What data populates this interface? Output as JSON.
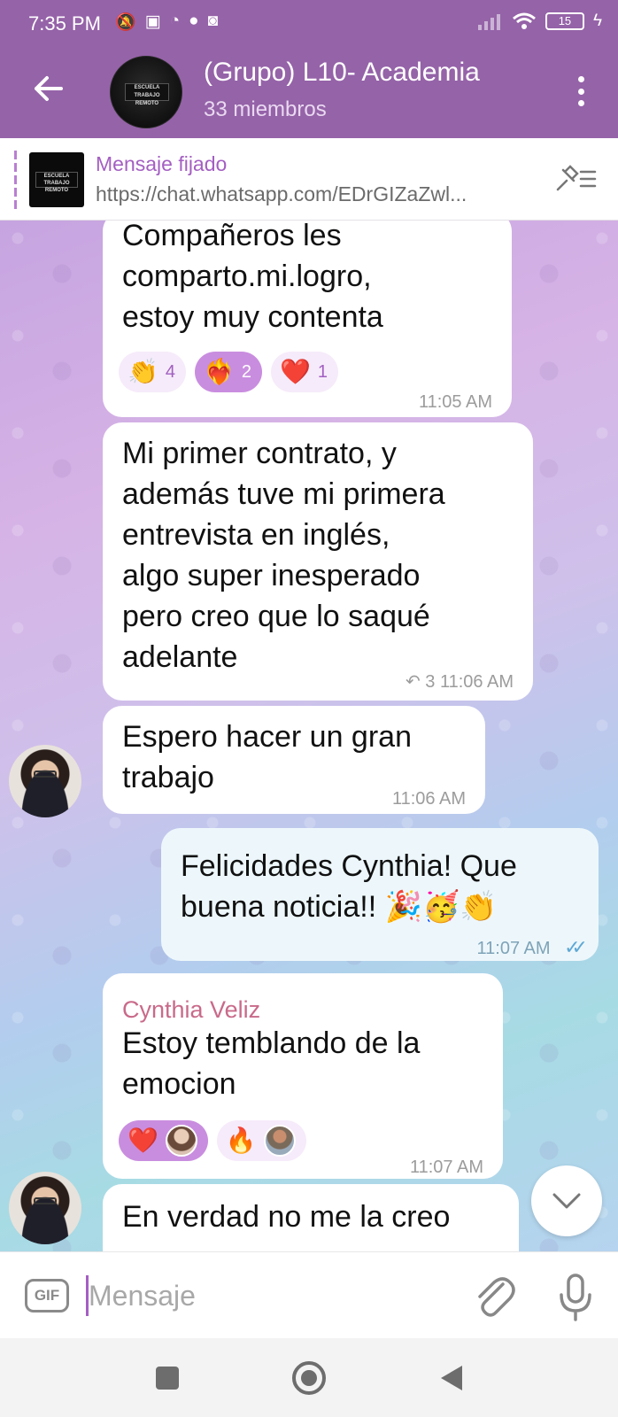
{
  "status_bar": {
    "time": "7:35 PM",
    "battery": "15"
  },
  "header": {
    "title": "(Grupo) L10- Academia",
    "subtitle": "33 miembros",
    "avatar_text": "ESCUELA TRABAJO REMOTO"
  },
  "pinned": {
    "label": "Mensaje fijado",
    "text": "https://chat.whatsapp.com/EDrGIZaZwl..."
  },
  "messages": [
    {
      "lines": [
        "Compañeros les",
        "comparto.mi.logro,",
        "estoy muy contenta"
      ],
      "time": "11:05 AM",
      "reactions": [
        {
          "emoji": "👏",
          "count": "4"
        },
        {
          "emoji": "❤️‍🔥",
          "count": "2"
        },
        {
          "emoji": "❤️",
          "count": "1"
        }
      ]
    },
    {
      "lines": [
        "Mi primer contrato, y",
        "además tuve mi primera",
        "entrevista en inglés,",
        "algo super inesperado",
        "pero creo que lo saqué",
        "adelante"
      ],
      "replies": "3",
      "time": "11:06 AM"
    },
    {
      "lines": [
        "Espero hacer un gran",
        "trabajo"
      ],
      "time": "11:06 AM"
    },
    {
      "lines": [
        "Felicidades Cynthia! Que",
        "buena noticia!! 🎉🥳👏"
      ],
      "time": "11:07 AM"
    },
    {
      "sender": "Cynthia Veliz",
      "lines": [
        "Estoy temblando de la",
        "emocion"
      ],
      "time": "11:07 AM",
      "reactions": [
        {
          "emoji": "❤️"
        },
        {
          "emoji": "🔥"
        }
      ]
    },
    {
      "lines": [
        "En verdad no me la creo"
      ]
    }
  ],
  "input": {
    "placeholder": "Mensaje",
    "gif_label": "GIF"
  },
  "colors": {
    "header": "#9563a8",
    "accent": "#a45fc2",
    "sender_name": "#c96a8a"
  }
}
